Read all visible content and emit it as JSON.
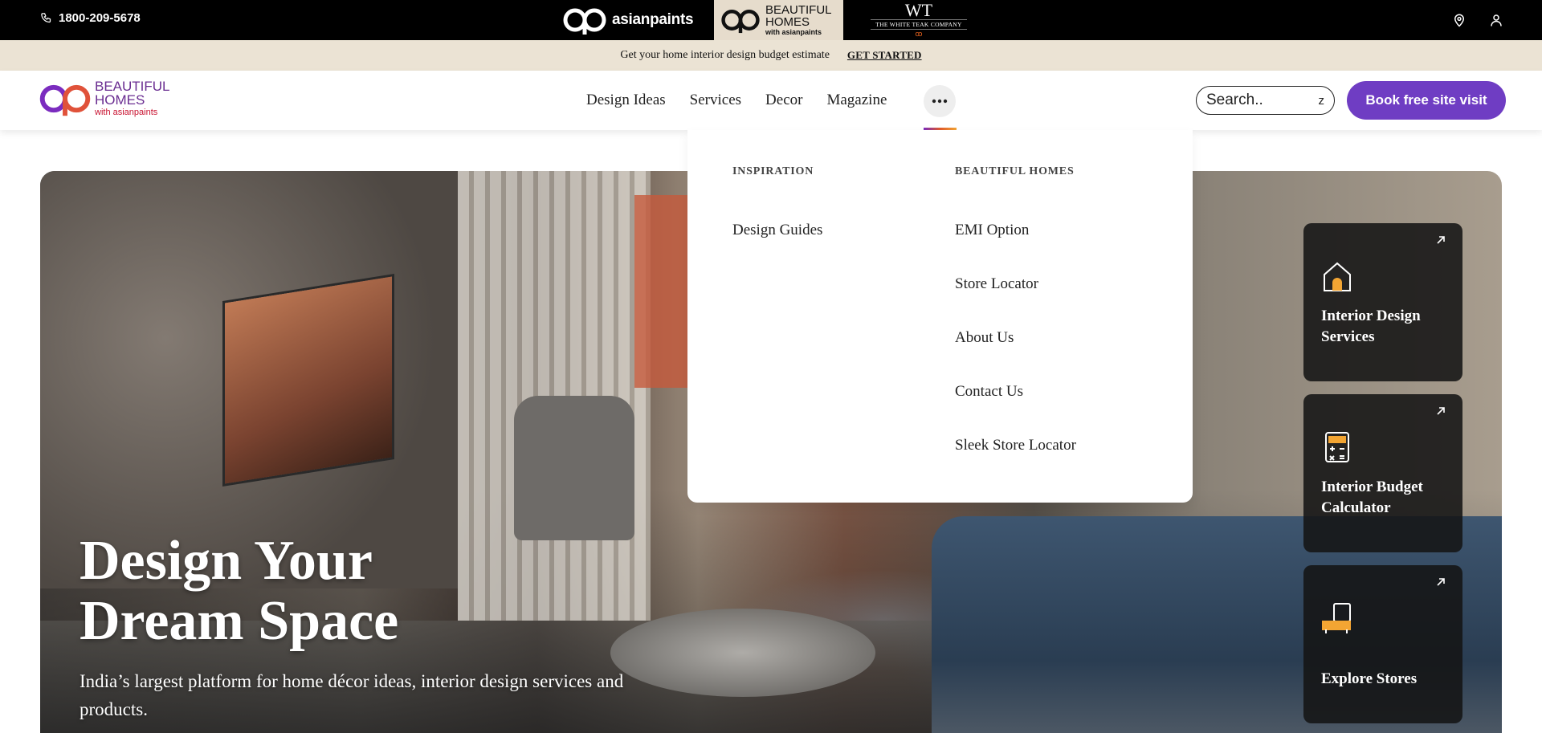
{
  "topbar": {
    "phone": "1800-209-5678",
    "brands": {
      "asianpaints": "asianpaints",
      "bh_line1": "BEAUTIFUL",
      "bh_line2": "HOMES",
      "bh_line3": "with asianpaints",
      "wt_mono": "WT",
      "wt_name": "THE WHITE TEAK COMPANY"
    },
    "icons": [
      "location-icon",
      "user-icon"
    ]
  },
  "announcement": {
    "text": "Get your home interior design budget estimate",
    "cta": "GET STARTED"
  },
  "header": {
    "logo": {
      "line1": "BEAUTIFUL",
      "line2": "HOMES",
      "line3": "with asianpaints"
    },
    "nav": [
      "Design Ideas",
      "Services",
      "Decor",
      "Magazine"
    ],
    "search": {
      "placeholder": "Search..",
      "suffix": "z"
    },
    "book_button": "Book free site visit"
  },
  "dropdown": {
    "inspiration": {
      "heading": "INSPIRATION",
      "items": [
        "Design Guides"
      ]
    },
    "beautiful_homes": {
      "heading": "BEAUTIFUL HOMES",
      "items": [
        "EMI Option",
        "Store Locator",
        "About Us",
        "Contact Us",
        "Sleek Store Locator"
      ]
    }
  },
  "hero": {
    "title_line1": "Design Your",
    "title_line2": "Dream Space",
    "subtitle": "India’s largest platform for home décor ideas, interior design services and products.",
    "cards": [
      {
        "label": "Interior Design Services",
        "icon": "house-icon"
      },
      {
        "label": "Interior Budget Calculator",
        "icon": "calculator-icon"
      },
      {
        "label": "Explore Stores",
        "icon": "sofa-icon"
      }
    ]
  },
  "colors": {
    "accent": "#6f3dc3",
    "topbar": "#000000",
    "strip": "#ebe3d4"
  }
}
